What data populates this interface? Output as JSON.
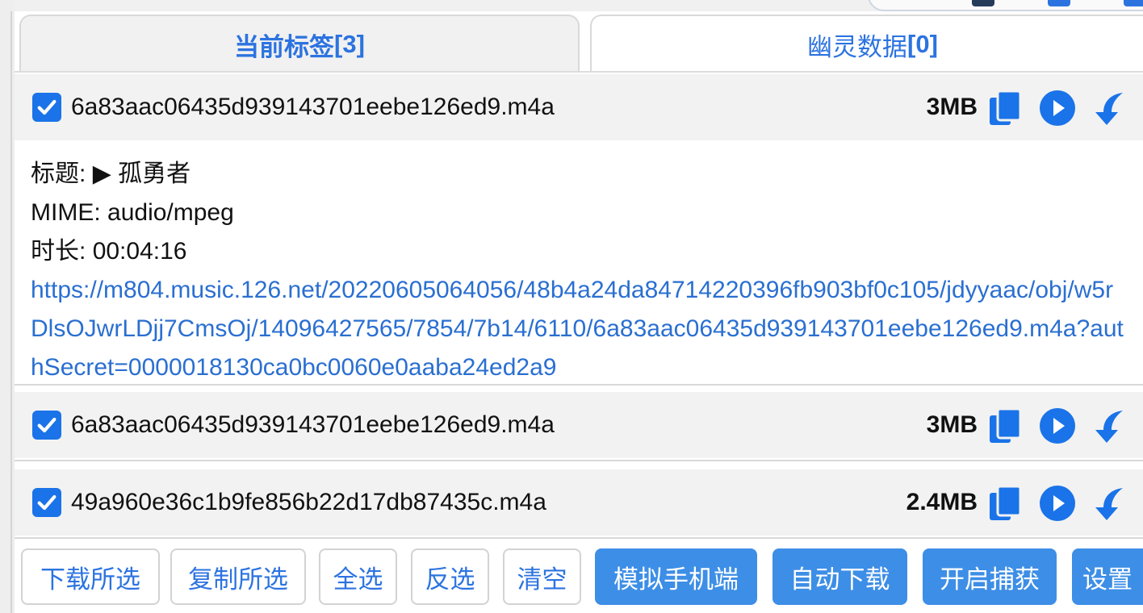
{
  "tabs": {
    "current_label": "当前标签",
    "current_count": "[3]",
    "ghost_label": "幽灵数据",
    "ghost_count": "[0]"
  },
  "rows": [
    {
      "filename": "6a83aac06435d939143701eebe126ed9.m4a",
      "size": "3MB",
      "checked": true
    },
    {
      "filename": "6a83aac06435d939143701eebe126ed9.m4a",
      "size": "3MB",
      "checked": true
    },
    {
      "filename": "49a960e36c1b9fe856b22d17db87435c.m4a",
      "size": "2.4MB",
      "checked": true
    }
  ],
  "detail": {
    "title_label": "标题:",
    "title_value": "▶ 孤勇者",
    "mime_label": "MIME:",
    "mime_value": "audio/mpeg",
    "duration_label": "时长:",
    "duration_value": "00:04:16",
    "url": "https://m804.music.126.net/20220605064056/48b4a24da84714220396fb903bf0c105/jdyyaac/obj/w5rDlsOJwrLDjj7CmsOj/14096427565/7854/7b14/6110/6a83aac06435d939143701eebe126ed9.m4a?authSecret=0000018130ca0bc0060e0aaba24ed2a9"
  },
  "footer": {
    "download_selected": "下载所选",
    "copy_selected": "复制所选",
    "select_all": "全选",
    "invert_selection": "反选",
    "clear": "清空",
    "simulate_mobile": "模拟手机端",
    "auto_download": "自动下载",
    "start_capture": "开启捕获",
    "settings": "设置"
  },
  "colors": {
    "accent": "#2c73e0",
    "solid_button": "#3d8ee6",
    "checkbox": "#1a73e8",
    "link": "#2a6fd1"
  },
  "icons": {
    "copy": "copy-icon",
    "play": "play-icon",
    "download": "download-icon",
    "checkbox": "checkbox-checked-icon"
  }
}
